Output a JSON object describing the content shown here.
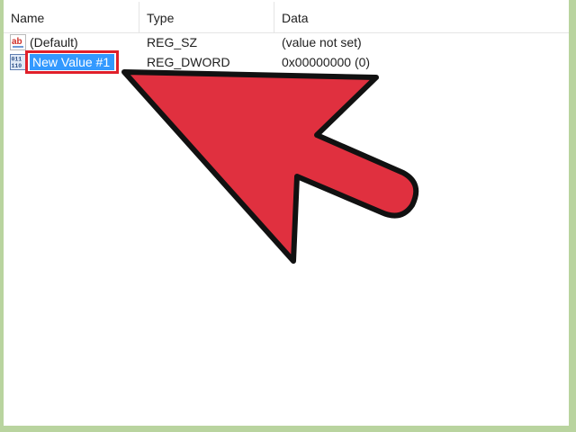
{
  "columns": {
    "name": "Name",
    "type": "Type",
    "data": "Data"
  },
  "rows": [
    {
      "icon": "string-value-icon",
      "icon_text": "ab",
      "name": "(Default)",
      "type": "REG_SZ",
      "data": "(value not set)"
    },
    {
      "icon": "binary-value-icon",
      "icon_text": "011 110",
      "name": "New Value #1",
      "type": "REG_DWORD",
      "data": "0x00000000 (0)",
      "editing": true
    }
  ],
  "colors": {
    "frame_background": "#b9d49f",
    "selection_highlight": "#3399ff",
    "callout_border": "#e0202a",
    "arrow_fill": "#e0303f",
    "arrow_outline": "#111111"
  },
  "annotation": "arrow-icon"
}
